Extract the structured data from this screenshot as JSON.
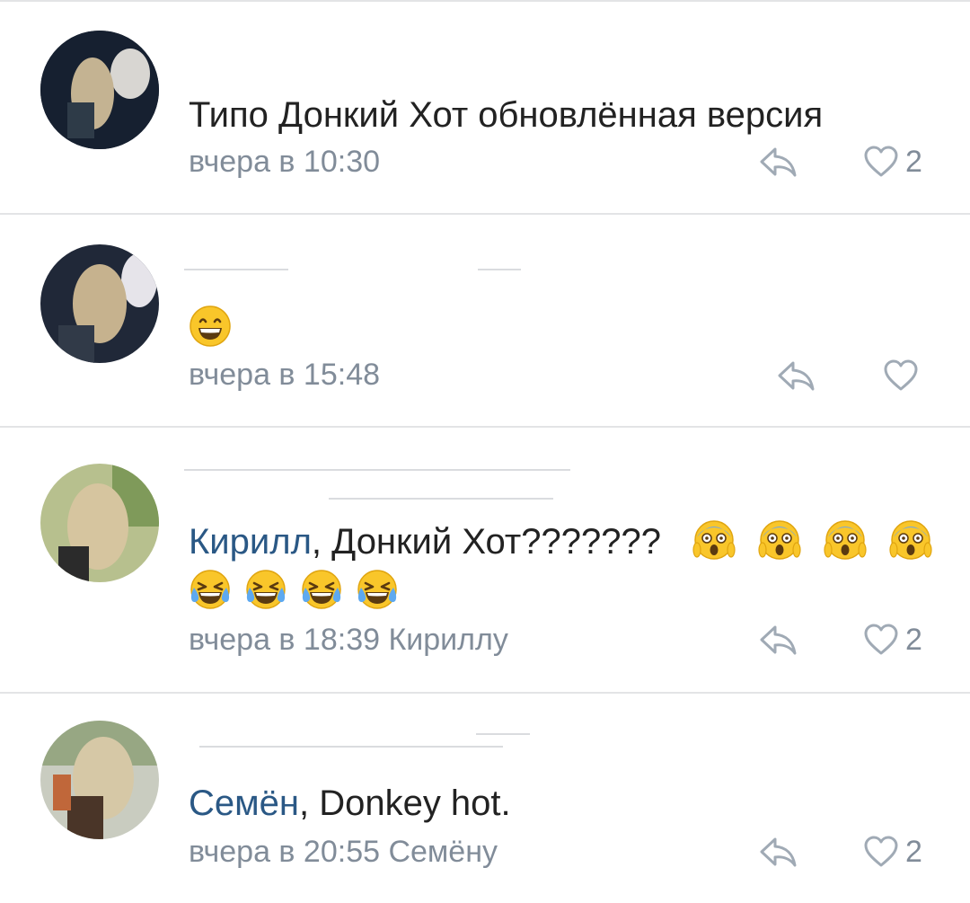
{
  "comments": [
    {
      "text": "Типо Донкий Хот обновлённая версия",
      "time": "вчера в 10:30",
      "likes": "2"
    },
    {
      "text": "",
      "time": "вчера в 15:48",
      "likes": ""
    },
    {
      "mention": "Кирилл",
      "text": ", Донкий Хот???????",
      "time": "вчера в 18:39 Кириллу",
      "likes": "2"
    },
    {
      "mention": "Семён",
      "text": ", Donkey hot.",
      "time": "вчера в 20:55 Семёну",
      "likes": "2"
    }
  ],
  "colors": {
    "text": "#222222",
    "mention": "#2a5885",
    "meta": "#818c99",
    "divider": "#e3e4e6"
  },
  "icons": [
    "reply-icon",
    "heart-icon",
    "grinning-emoji",
    "screaming-emoji",
    "tears-of-joy-emoji"
  ]
}
